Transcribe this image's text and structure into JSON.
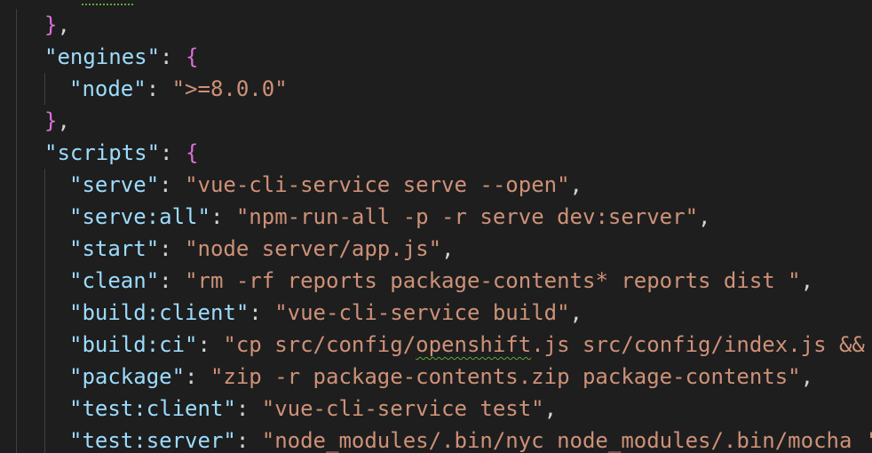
{
  "editor": {
    "theme_colors": {
      "background": "#1e1e1e",
      "key": "#9cdcfe",
      "string": "#ce9178",
      "punctuation": "#d4d4d4",
      "brace": "#da70d6",
      "squiggle": "#5fa832"
    },
    "lines": [
      {
        "close": "}",
        "comma": ","
      },
      {
        "key": "\"engines\"",
        "colon": ": ",
        "open": "{"
      },
      {
        "key": "\"node\"",
        "colon": ": ",
        "value": "\">=8.0.0\""
      },
      {
        "close": "}",
        "comma": ","
      },
      {
        "key": "\"scripts\"",
        "colon": ": ",
        "open": "{"
      },
      {
        "key": "\"serve\"",
        "colon": ": ",
        "value": "\"vue-cli-service serve --open\"",
        "comma": ","
      },
      {
        "key": "\"serve:all\"",
        "colon": ": ",
        "value": "\"npm-run-all -p -r serve dev:server\"",
        "comma": ","
      },
      {
        "key": "\"start\"",
        "colon": ": ",
        "value": "\"node server/app.js\"",
        "comma": ","
      },
      {
        "key": "\"clean\"",
        "colon": ": ",
        "value": "\"rm -rf reports package-contents* reports dist \"",
        "comma": ","
      },
      {
        "key": "\"build:client\"",
        "colon": ": ",
        "value": "\"vue-cli-service build\"",
        "comma": ","
      },
      {
        "key": "\"build:ci\"",
        "colon": ": ",
        "value_pre": "\"cp src/config/",
        "value_squiggle": "openshift",
        "value_post": ".js src/config/index.js &&"
      },
      {
        "key": "\"package\"",
        "colon": ": ",
        "value": "\"zip -r package-contents.zip package-contents\"",
        "comma": ","
      },
      {
        "key": "\"test:client\"",
        "colon": ": ",
        "value": "\"vue-cli-service test\"",
        "comma": ","
      },
      {
        "key": "\"test:server\"",
        "colon": ": ",
        "value": "\"node_modules/.bin/nyc node_modules/.bin/mocha '"
      }
    ]
  }
}
